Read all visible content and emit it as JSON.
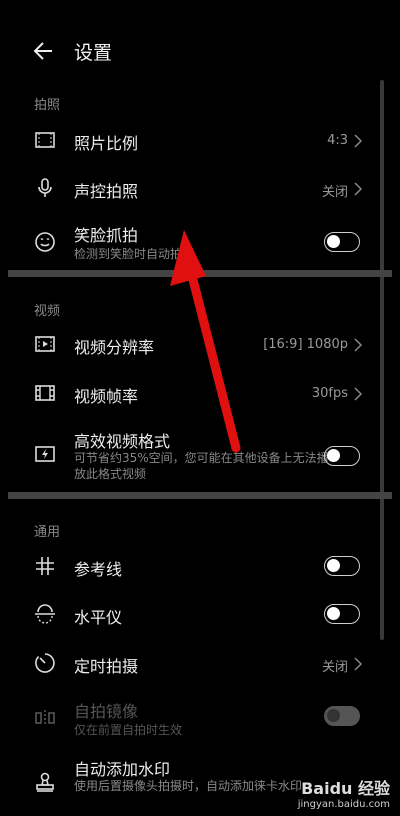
{
  "header": {
    "title": "设置"
  },
  "sections": {
    "photo": "拍照",
    "video": "视频",
    "general": "通用"
  },
  "rows": {
    "aspect": {
      "label": "照片比例",
      "value": "4:3"
    },
    "voice": {
      "label": "声控拍照",
      "value": "关闭"
    },
    "smile": {
      "label": "笑脸抓拍",
      "sub": "检测到笑脸时自动拍照",
      "on": false
    },
    "resolution": {
      "label": "视频分辨率",
      "value": "[16:9] 1080p"
    },
    "framerate": {
      "label": "视频帧率",
      "value": "30fps"
    },
    "efficient": {
      "label": "高效视频格式",
      "sub": "可节省约35%空间，您可能在其他设备上无法播放此格式视频",
      "on": false
    },
    "grid": {
      "label": "参考线",
      "on": false
    },
    "level": {
      "label": "水平仪",
      "on": false
    },
    "timer": {
      "label": "定时拍摄",
      "value": "关闭"
    },
    "mirror": {
      "label": "自拍镜像",
      "sub": "仅在前置自拍时生效",
      "on": false,
      "disabled": true
    },
    "watermark": {
      "label": "自动添加水印",
      "sub": "使用后置摄像头拍摄时，自动添加徕卡水印"
    }
  },
  "watermark": {
    "brand": "Baidu 经验",
    "url": "jingyan.baidu.com"
  },
  "colors": {
    "background": "#000000",
    "arrow": "#e01010",
    "divider": "#444444"
  },
  "icons": [
    "back-arrow-icon",
    "aspect-ratio-icon",
    "microphone-icon",
    "smile-icon",
    "video-resolution-icon",
    "film-icon",
    "efficient-format-icon",
    "grid-icon",
    "level-icon",
    "timer-icon",
    "mirror-icon",
    "stamp-icon"
  ]
}
